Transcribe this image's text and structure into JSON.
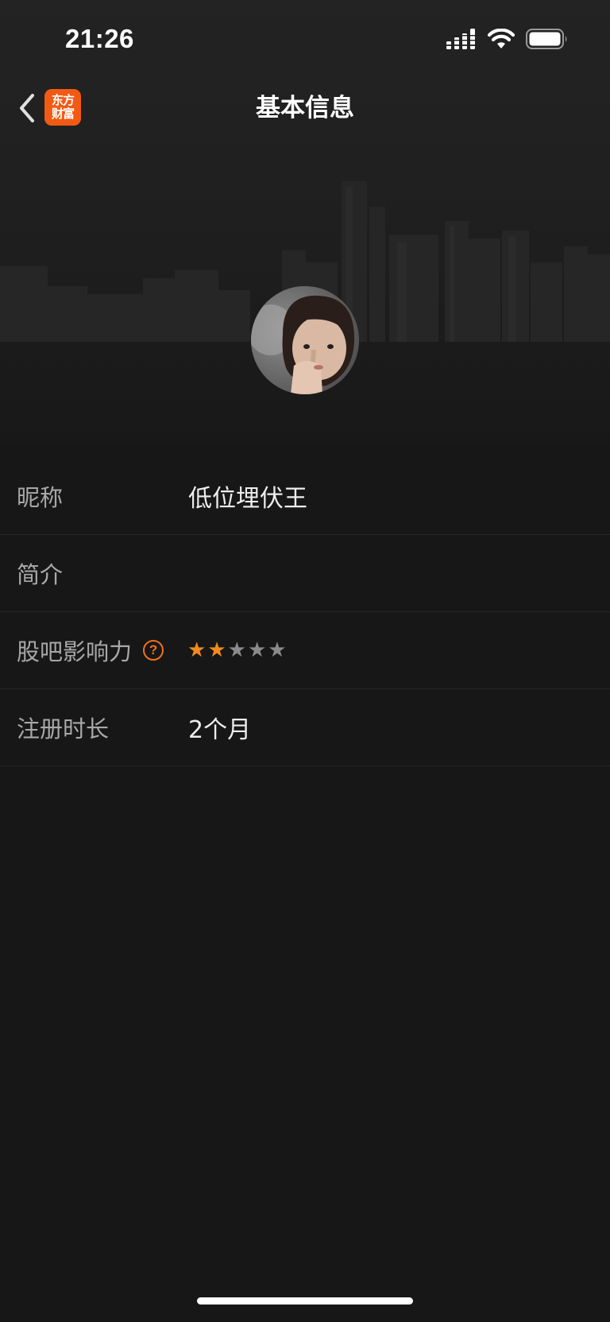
{
  "status_bar": {
    "time": "21:26",
    "icons": [
      "cellular-signal-icon",
      "wifi-icon",
      "battery-icon"
    ]
  },
  "nav": {
    "back_icon": "chevron-left-icon",
    "brand_logo": {
      "line1": "东方",
      "line2": "财富",
      "color": "#f25a14"
    },
    "title": "基本信息"
  },
  "profile": {
    "avatar": "user-avatar"
  },
  "info": {
    "nickname": {
      "label": "昵称",
      "value": "低位埋伏王"
    },
    "bio": {
      "label": "简介",
      "value": ""
    },
    "influence": {
      "label": "股吧影响力",
      "help_icon": "question-icon",
      "rating": 2,
      "max": 5,
      "filled_color": "#f28a1c",
      "empty_color": "#8a8a8a"
    },
    "register_duration": {
      "label": "注册时长",
      "value": "2个月"
    }
  },
  "colors": {
    "background": "#171717",
    "accent": "#f0701e"
  }
}
